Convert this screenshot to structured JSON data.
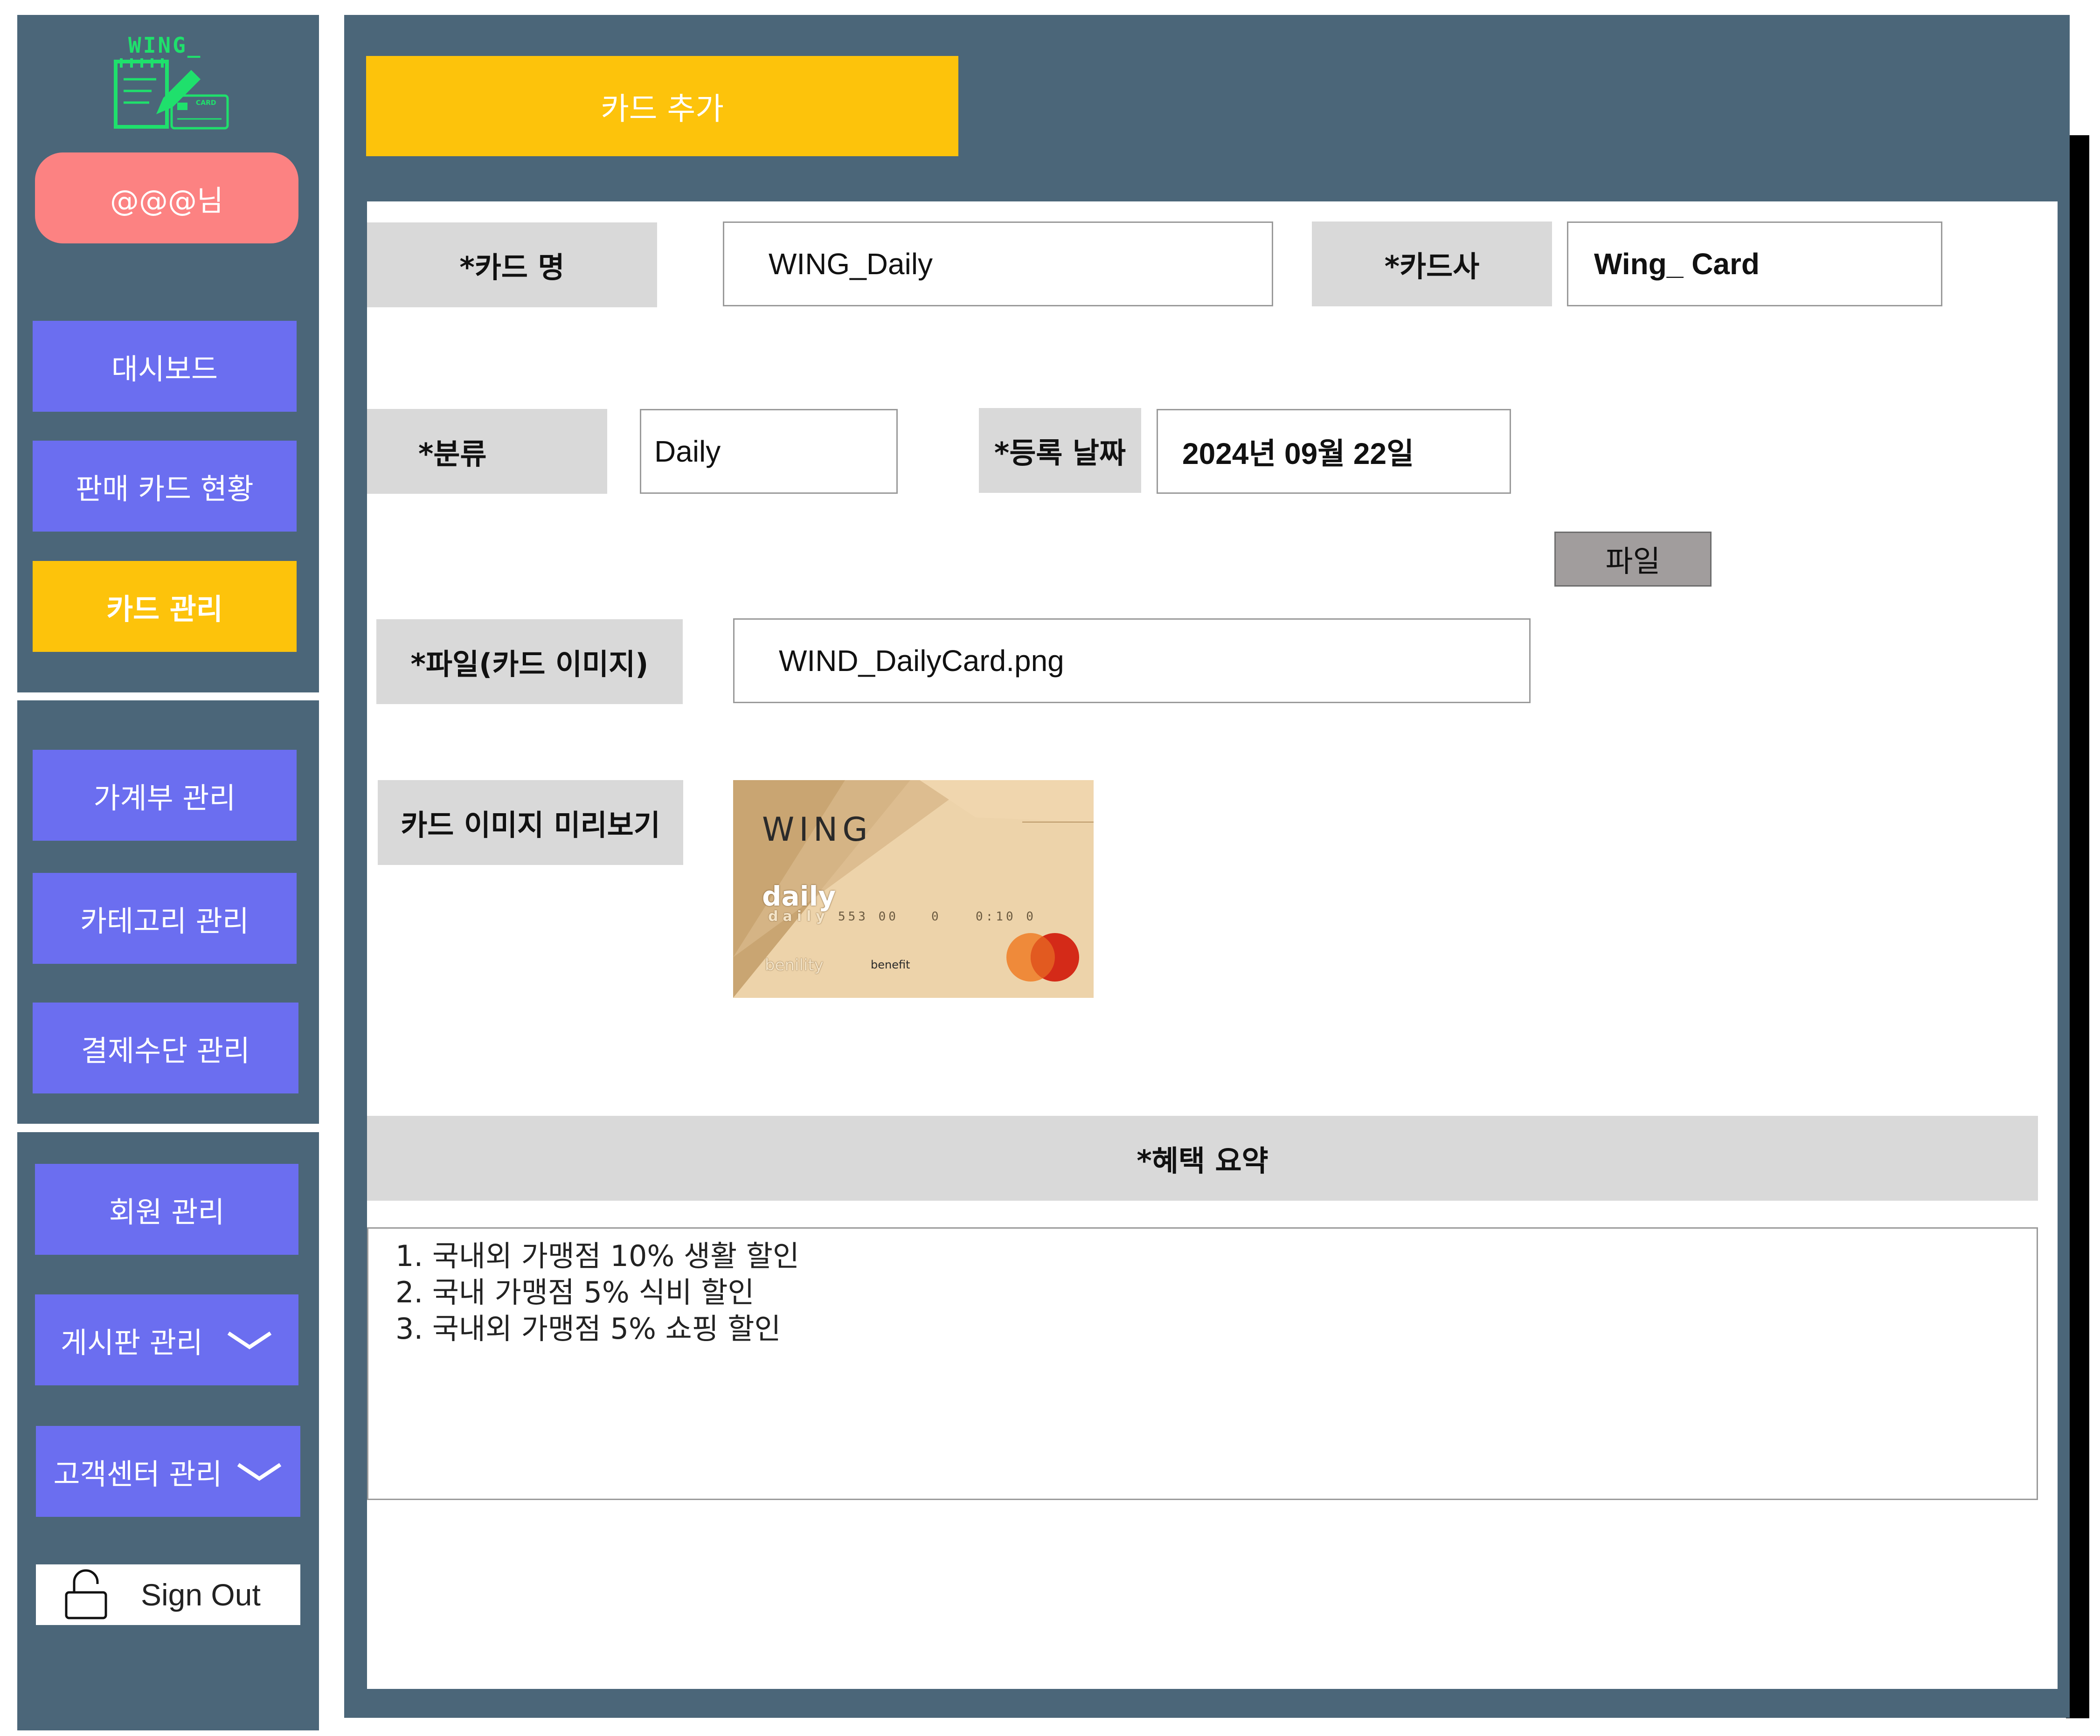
{
  "brand": {
    "logo_text": "WING_",
    "logo_card_text": "CARD",
    "logo_color": "#1fe06c"
  },
  "user": {
    "greeting": "@@@님"
  },
  "sidebar": {
    "group1": [
      {
        "label": "대시보드"
      },
      {
        "label": "판매 카드 현황"
      },
      {
        "label": "카드 관리",
        "active": true
      }
    ],
    "group2": [
      {
        "label": "가계부 관리"
      },
      {
        "label": "카테고리 관리"
      },
      {
        "label": "결제수단 관리"
      }
    ],
    "group3": [
      {
        "label": "회원 관리"
      },
      {
        "label": "게시판 관리",
        "icon": "chevron-down-icon"
      },
      {
        "label": "고객센터 관리",
        "icon": "chevron-down-icon"
      }
    ],
    "signout": {
      "label": "Sign Out",
      "icon": "unlock-icon"
    }
  },
  "main": {
    "add_card_label": "카드 추가",
    "form": {
      "card_name": {
        "label": "*카드 명",
        "value": "WING_Daily"
      },
      "card_company": {
        "label": "*카드사",
        "value": "Wing_ Card"
      },
      "category": {
        "label": "*분류",
        "value": "Daily"
      },
      "reg_date": {
        "label": "*등록 날짜",
        "value": "2024년 09월 22일"
      },
      "file_button": "파일",
      "file": {
        "label": "*파일(카드 이미지)",
        "value": "WIND_DailyCard.png"
      },
      "preview": {
        "label": "카드 이미지 미리보기"
      }
    },
    "card_preview": {
      "brand": "WING",
      "line1": "daily",
      "line2": "daily",
      "nums1": "553 00",
      "nums2": "0",
      "nums3": "0:10 0",
      "bottom_left": "benility",
      "bottom_mid": "benefit"
    },
    "benefits": {
      "title": "*혜택 요약",
      "items": [
        "1. 국내외 가맹점 10% 생활 할인",
        "2. 국내 가맹점 5% 식비 할인",
        "3. 국내외 가맹점 5% 쇼핑 할인"
      ]
    }
  },
  "colors": {
    "frame": "#4b6679",
    "nav": "#6b6ef0",
    "accent": "#fdc30b",
    "user_pill": "#fc8282",
    "label_bg": "#d9d9d9"
  }
}
